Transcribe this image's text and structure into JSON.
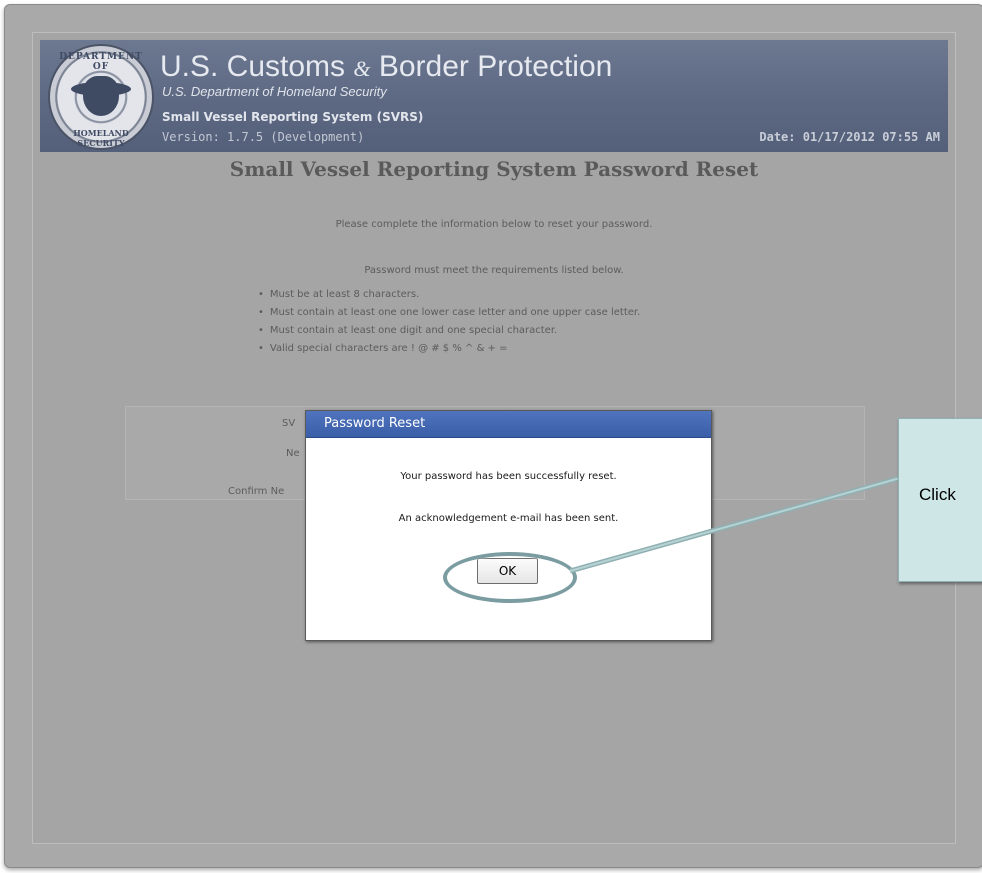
{
  "header": {
    "agency": "U.S. Customs",
    "agency_amp": "&",
    "agency_rest": "Border Protection",
    "department": "U.S. Department of Homeland Security",
    "seal_top": "DEPARTMENT OF",
    "seal_bottom": "HOMELAND SECURITY",
    "system_name": "Small Vessel Reporting System (SVRS)",
    "version": "Version: 1.7.5 (Development)",
    "date": "Date: 01/17/2012 07:55 AM"
  },
  "page": {
    "heading": "Small Vessel Reporting System Password Reset",
    "intro": "Please complete the information below to reset your password.",
    "requirements_intro": "Password must meet the requirements listed below.",
    "requirements": [
      "Must be at least 8 characters.",
      "Must contain at least one one lower case letter and one upper case letter.",
      "Must contain at least one digit and one special character.",
      "Valid special characters are ! @ # $ % ^ & + ="
    ],
    "form_labels": {
      "field1": "SV",
      "field2": "Ne",
      "field3": "Confirm Ne"
    }
  },
  "dialog": {
    "title": "Password Reset",
    "message1": "Your password has been successfully reset.",
    "message2": "An acknowledgement e-mail has been sent.",
    "ok_label": "OK"
  },
  "callout": {
    "text": "Click"
  },
  "colors": {
    "banner": "#5e6a84",
    "overlay": "#a5a5a5",
    "dialog_title_bar": "#3a5fa8",
    "callout_bg": "#cfe6e6",
    "highlight": "#7b9ca1"
  }
}
